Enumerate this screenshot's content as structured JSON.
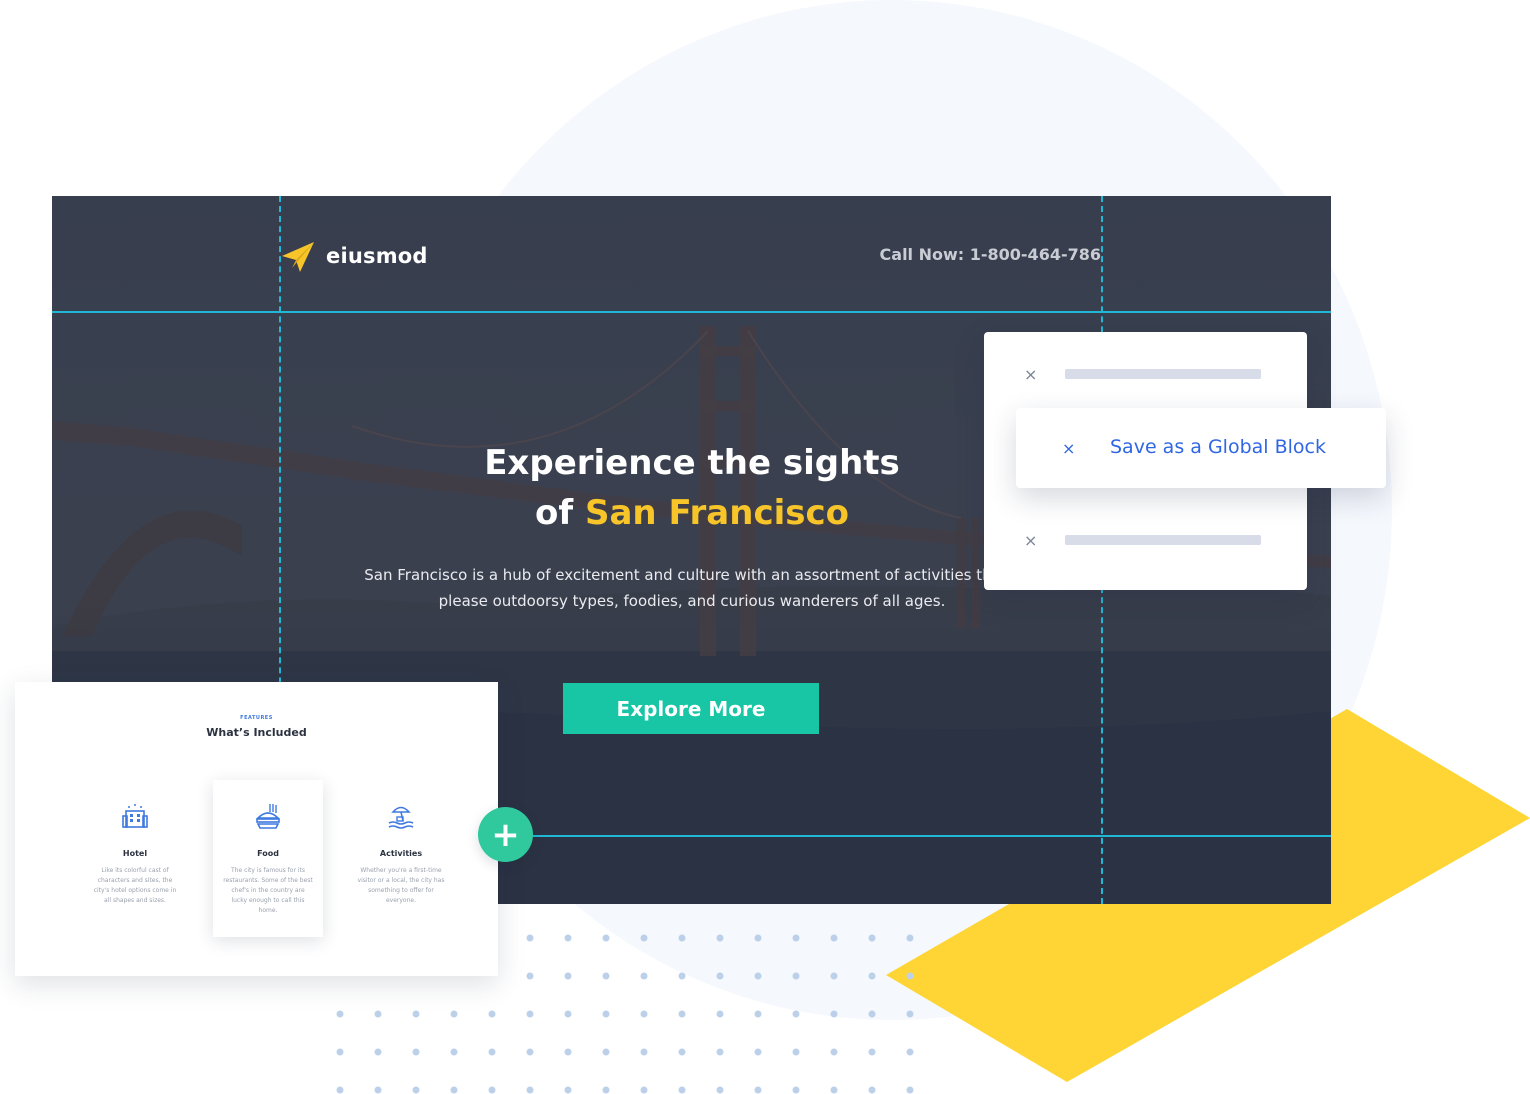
{
  "colors": {
    "accent_yellow": "#f7c52a",
    "cta_teal": "#18c6a6",
    "guide_cyan": "#21b8d6",
    "menu_blue": "#2f66e3",
    "add_green": "#2fc99d",
    "shape_yellow": "#fed534"
  },
  "hero": {
    "brand": "eiusmod",
    "call_now": "Call Now: 1-800-464-786",
    "headline_line1": "Experience the sights",
    "headline_prefix": "of ",
    "headline_highlight": "San Francisco",
    "lead_line1": "San Francisco is a hub of excitement and culture with an assortment of activities that c",
    "lead_line2": "please outdoorsy types, foodies, and curious wanderers of all ages.",
    "cta_label": "Explore More"
  },
  "context_menu": {
    "close_glyph": "×",
    "active_item_label": "Save as a Global Block"
  },
  "features": {
    "eyebrow": "FEATURES",
    "title": "What’s Included",
    "items": [
      {
        "icon": "hotel-icon",
        "name": "Hotel",
        "desc": "Like its colorful cast of characters and sites, the city's hotel options come in all shapes and sizes."
      },
      {
        "icon": "food-icon",
        "name": "Food",
        "desc": "The city is famous for its restaurants. Some of the best chef's in the country are lucky enough to call this home."
      },
      {
        "icon": "activities-icon",
        "name": "Activities",
        "desc": "Whether you're a first-time visitor or a local, the city has something to offer for everyone."
      }
    ]
  },
  "add_block": {
    "glyph": "+"
  }
}
